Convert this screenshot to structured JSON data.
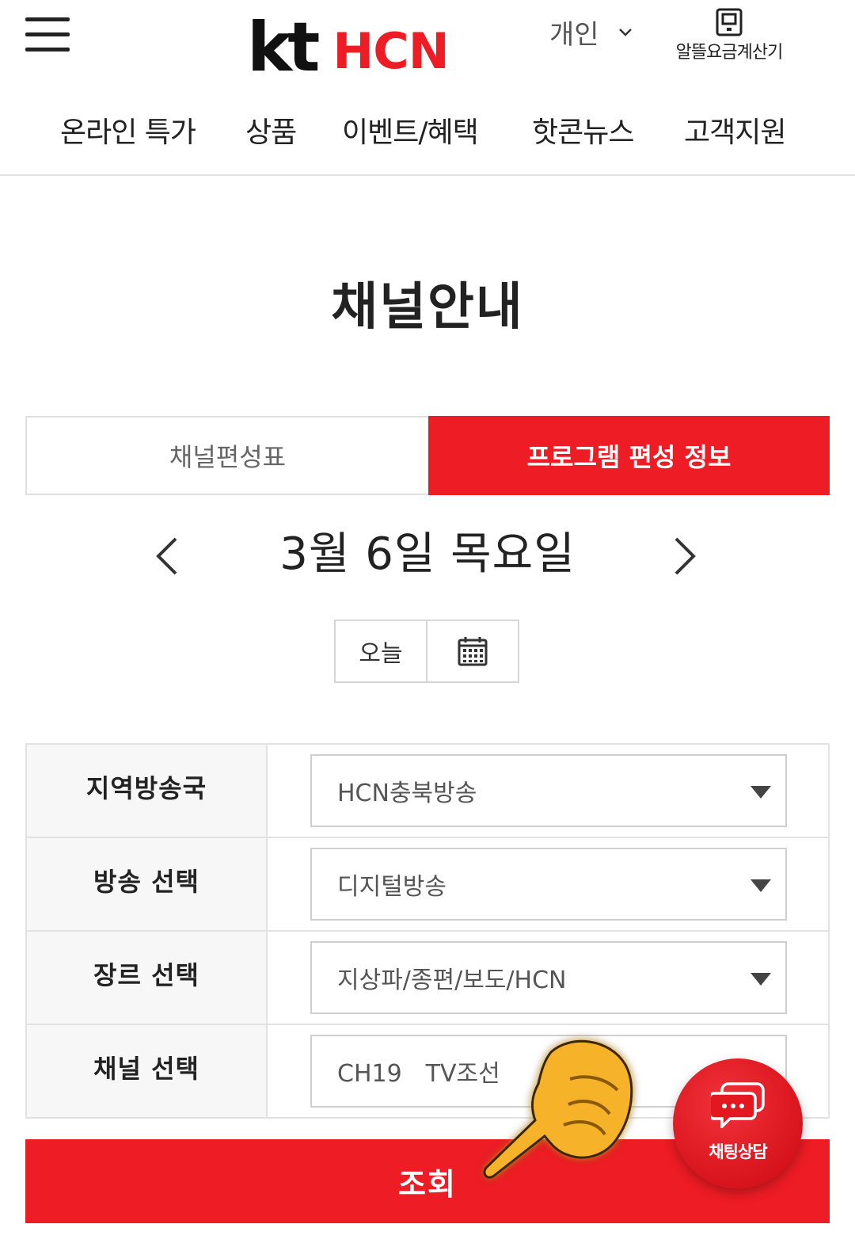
{
  "header": {
    "logo_kt": "kt",
    "logo_hcn": "HCN",
    "segment_label": "개인",
    "calculator_label": "알뜰요금계산기"
  },
  "nav": {
    "items": [
      {
        "label": "온라인 특가"
      },
      {
        "label": "상품"
      },
      {
        "label": "이벤트/혜택"
      },
      {
        "label": "핫콘뉴스"
      },
      {
        "label": "고객지원"
      }
    ]
  },
  "page": {
    "title": "채널안내"
  },
  "tabs": [
    {
      "label": "채널편성표",
      "active": false
    },
    {
      "label": "프로그램 편성 정보",
      "active": true
    }
  ],
  "date": {
    "display": "3월 6일 목요일",
    "today_label": "오늘"
  },
  "form": {
    "rows": [
      {
        "label": "지역방송국",
        "value": "HCN충북방송"
      },
      {
        "label": "방송 선택",
        "value": "디지털방송"
      },
      {
        "label": "장르 선택",
        "value": "지상파/종편/보도/HCN"
      },
      {
        "label": "채널 선택",
        "value": "CH19　TV조선"
      }
    ]
  },
  "search": {
    "label": "조회"
  },
  "chat": {
    "label": "채팅상담"
  },
  "colors": {
    "brand_red": "#ee1c24",
    "text_dark": "#222222",
    "border": "#e2e2e2",
    "label_bg": "#f7f7f7"
  },
  "icons": [
    "hamburger-menu-icon",
    "chevron-down-icon",
    "calculator-icon",
    "chevron-left-icon",
    "chevron-right-icon",
    "calendar-icon",
    "dropdown-caret-icon",
    "pointing-hand-icon",
    "chat-bubble-icon"
  ]
}
